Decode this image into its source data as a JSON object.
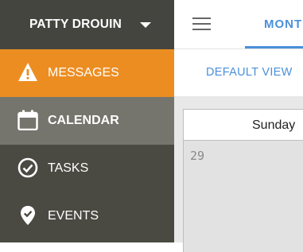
{
  "user": {
    "name": "PATTY DROUIN"
  },
  "sidebar": {
    "items": [
      {
        "label": "MESSAGES",
        "icon": "warning-icon",
        "state": "active"
      },
      {
        "label": "CALENDAR",
        "icon": "calendar-icon",
        "state": "hover"
      },
      {
        "label": "TASKS",
        "icon": "check-circle-icon",
        "state": "normal"
      },
      {
        "label": "EVENTS",
        "icon": "location-check-icon",
        "state": "normal"
      }
    ]
  },
  "topbar": {
    "tab_label": "MONTH"
  },
  "viewbar": {
    "default_view_label": "DEFAULT VIEW"
  },
  "calendar": {
    "day_header": "Sunday",
    "day_number": "29"
  },
  "colors": {
    "sidebar_bg": "#4a4a43",
    "active_bg": "#ec8d22",
    "hover_bg": "#75756d",
    "accent": "#4a90d9",
    "calendar_bg": "#e8e8e8"
  }
}
